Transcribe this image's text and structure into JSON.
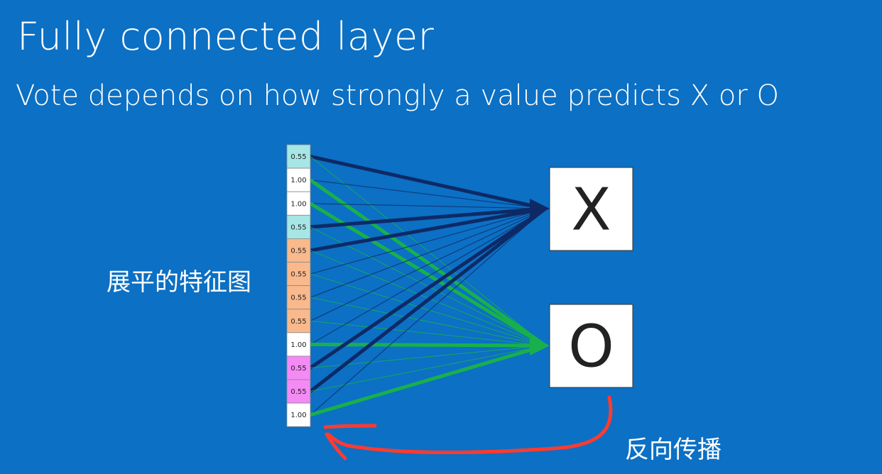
{
  "slide": {
    "title": "Fully connected layer",
    "subtitle": "Vote depends on how strongly a value predicts X or O"
  },
  "flattened_features_label": "展平的特征图",
  "backprop_label": "反向传播",
  "feature_vector": [
    {
      "value": "0.55",
      "color": "#a6e6e4"
    },
    {
      "value": "1.00",
      "color": "#ffffff"
    },
    {
      "value": "1.00",
      "color": "#ffffff"
    },
    {
      "value": "0.55",
      "color": "#a6e6e4"
    },
    {
      "value": "0.55",
      "color": "#f9b98c"
    },
    {
      "value": "0.55",
      "color": "#f9b98c"
    },
    {
      "value": "0.55",
      "color": "#f9b98c"
    },
    {
      "value": "0.55",
      "color": "#f9b98c"
    },
    {
      "value": "1.00",
      "color": "#ffffff"
    },
    {
      "value": "0.55",
      "color": "#f48af4"
    },
    {
      "value": "0.55",
      "color": "#f48af4"
    },
    {
      "value": "1.00",
      "color": "#ffffff"
    }
  ],
  "outputs": [
    {
      "label": "X",
      "arrow_color": "#0d2a66"
    },
    {
      "label": "O",
      "arrow_color": "#18b04c"
    }
  ],
  "strong_x_inputs": [
    0,
    3,
    4,
    9,
    10
  ],
  "strong_o_inputs": [
    1,
    2,
    8,
    11
  ],
  "colors": {
    "background": "#0c70c4",
    "x_connection": "#0d2a66",
    "o_connection": "#18b04c",
    "backprop_stroke": "#ff3b30"
  }
}
